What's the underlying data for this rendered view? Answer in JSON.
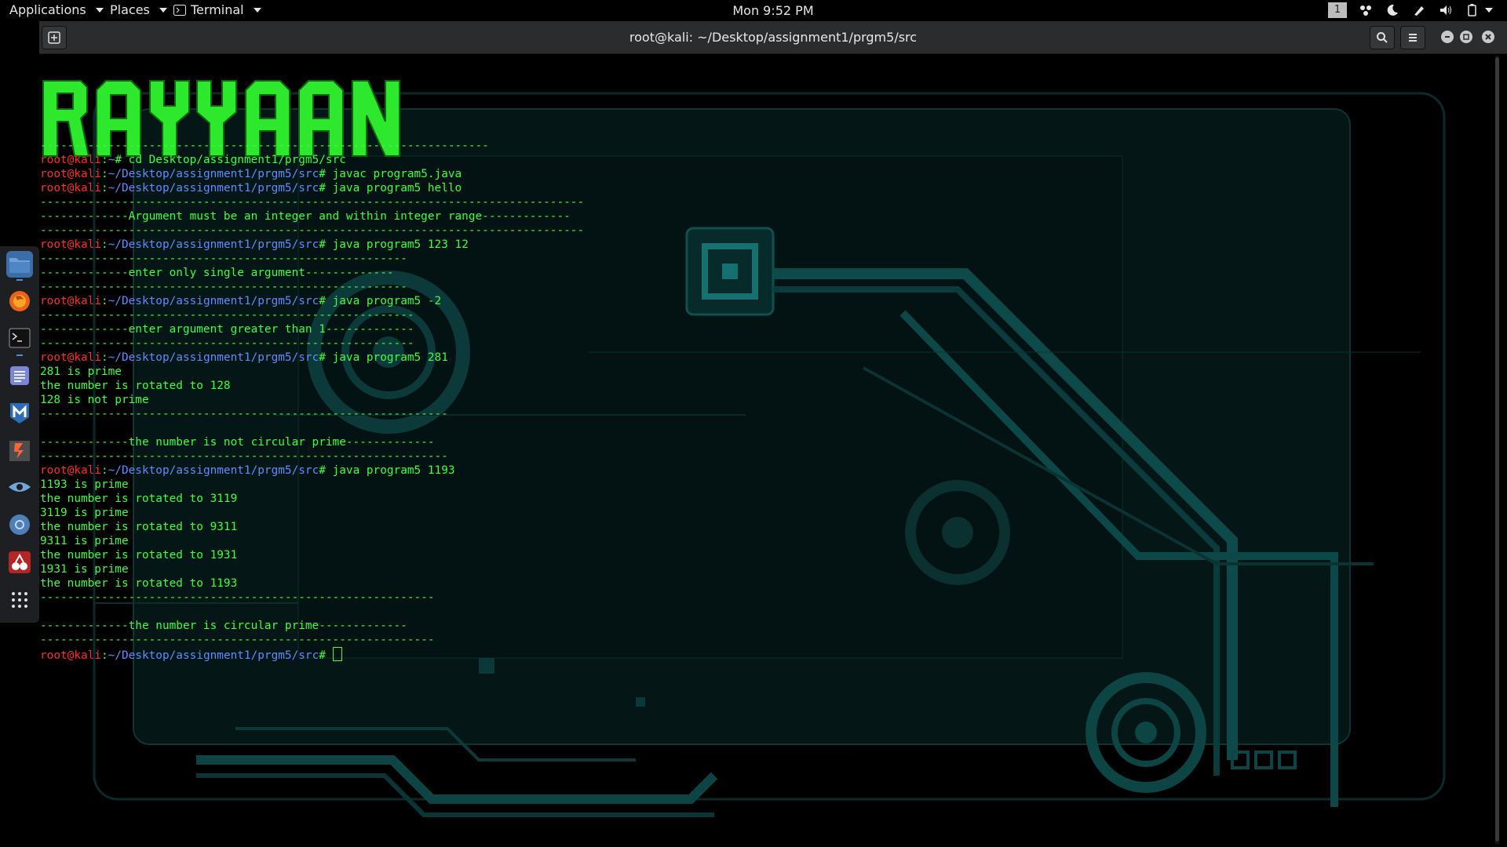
{
  "topbar": {
    "applications": "Applications",
    "places": "Places",
    "terminal": "Terminal",
    "clock": "Mon 9:52 PM",
    "workspace": "1"
  },
  "window": {
    "title": "root@kali: ~/Desktop/assignment1/prgm5/src"
  },
  "banner_text": "RAYYAAN",
  "terminal": {
    "lines": [
      {
        "kind": "dash",
        "text": "------------------------------------------------------------------"
      },
      {
        "kind": "prompt",
        "user": "root@kali",
        "sep": ":",
        "path": "~",
        "cmd": "# cd Desktop/assignment1/prgm5/src"
      },
      {
        "kind": "prompt",
        "user": "root@kali",
        "sep": ":",
        "path": "~/Desktop/assignment1/prgm5/src",
        "cmd": "# javac program5.java"
      },
      {
        "kind": "prompt",
        "user": "root@kali",
        "sep": ":",
        "path": "~/Desktop/assignment1/prgm5/src",
        "cmd": "# java program5 hello"
      },
      {
        "kind": "out",
        "text": "--------------------------------------------------------------------------------"
      },
      {
        "kind": "out",
        "text": "-------------Argument must be an integer and within integer range-------------"
      },
      {
        "kind": "out",
        "text": "--------------------------------------------------------------------------------"
      },
      {
        "kind": "prompt",
        "user": "root@kali",
        "sep": ":",
        "path": "~/Desktop/assignment1/prgm5/src",
        "cmd": "# java program5 123 12"
      },
      {
        "kind": "out",
        "text": "------------------------------------------------------"
      },
      {
        "kind": "out",
        "text": "-------------enter only single argument-------------"
      },
      {
        "kind": "out",
        "text": "------------------------------------------------------"
      },
      {
        "kind": "prompt",
        "user": "root@kali",
        "sep": ":",
        "path": "~/Desktop/assignment1/prgm5/src",
        "cmd": "# java program5 -2"
      },
      {
        "kind": "out",
        "text": "-------------------------------------------------------"
      },
      {
        "kind": "out",
        "text": "-------------enter argument greater than 1-------------"
      },
      {
        "kind": "out",
        "text": "-------------------------------------------------------"
      },
      {
        "kind": "prompt",
        "user": "root@kali",
        "sep": ":",
        "path": "~/Desktop/assignment1/prgm5/src",
        "cmd": "# java program5 281"
      },
      {
        "kind": "out",
        "text": "281 is prime"
      },
      {
        "kind": "out",
        "text": "the number is rotated to 128"
      },
      {
        "kind": "out",
        "text": "128 is not prime"
      },
      {
        "kind": "out",
        "text": "------------------------------------------------------------"
      },
      {
        "kind": "out",
        "text": ""
      },
      {
        "kind": "out",
        "text": "-------------the number is not circular prime-------------"
      },
      {
        "kind": "out",
        "text": "------------------------------------------------------------"
      },
      {
        "kind": "prompt",
        "user": "root@kali",
        "sep": ":",
        "path": "~/Desktop/assignment1/prgm5/src",
        "cmd": "# java program5 1193"
      },
      {
        "kind": "out",
        "text": "1193 is prime"
      },
      {
        "kind": "out",
        "text": "the number is rotated to 3119"
      },
      {
        "kind": "out",
        "text": "3119 is prime"
      },
      {
        "kind": "out",
        "text": "the number is rotated to 9311"
      },
      {
        "kind": "out",
        "text": "9311 is prime"
      },
      {
        "kind": "out",
        "text": "the number is rotated to 1931"
      },
      {
        "kind": "out",
        "text": "1931 is prime"
      },
      {
        "kind": "out",
        "text": "the number is rotated to 1193"
      },
      {
        "kind": "out",
        "text": "----------------------------------------------------------"
      },
      {
        "kind": "out",
        "text": ""
      },
      {
        "kind": "out",
        "text": "-------------the number is circular prime-------------"
      },
      {
        "kind": "out",
        "text": "----------------------------------------------------------"
      },
      {
        "kind": "prompt",
        "user": "root@kali",
        "sep": ":",
        "path": "~/Desktop/assignment1/prgm5/src",
        "cmd": "# ",
        "cursor": true
      }
    ]
  },
  "dock": {
    "apps": [
      "files-icon",
      "firefox-icon",
      "terminal-icon",
      "text-editor-icon",
      "metasploit-icon",
      "burpsuite-icon",
      "eye-icon",
      "chrome-icon",
      "cherrytree-icon",
      "show-apps-icon"
    ]
  },
  "colors": {
    "user": "#ff2b2b",
    "path": "#5c8cff",
    "text": "#3aff3a",
    "background": "#000000",
    "circuit": "#0e3d3d"
  }
}
